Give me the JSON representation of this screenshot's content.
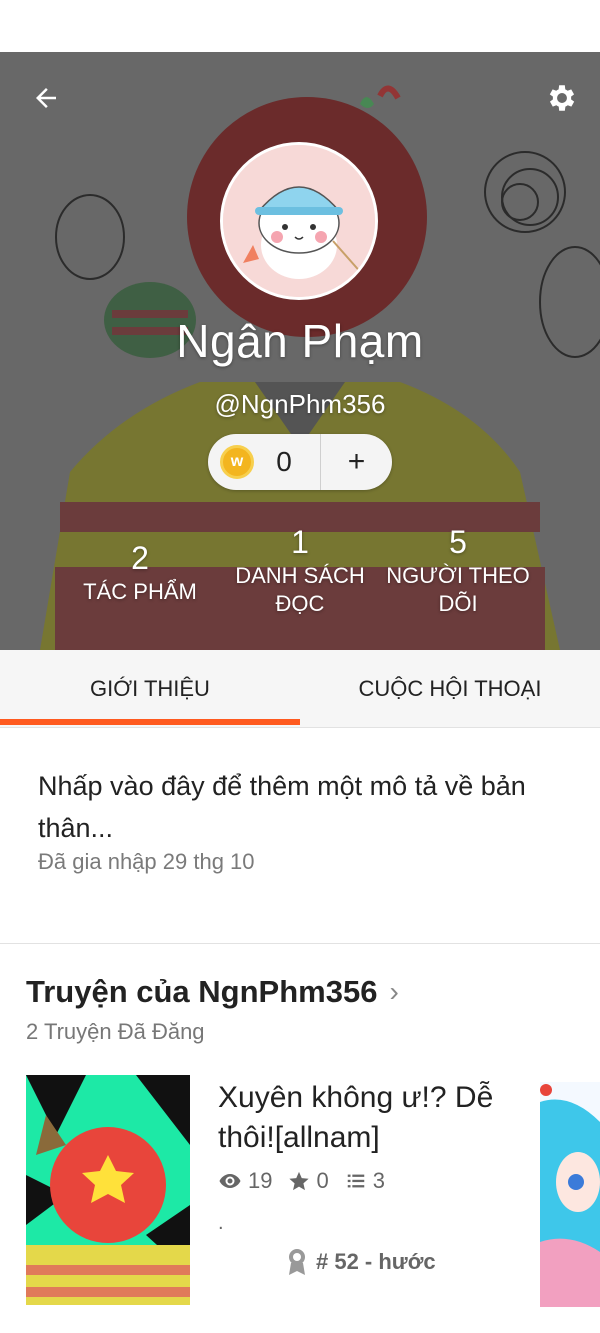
{
  "profile": {
    "display_name": "Ngân Phạm",
    "username": "@NgnPhm356",
    "coins": "0",
    "add_coin_label": "+"
  },
  "stats": [
    {
      "value": "2",
      "label": "TÁC PHẨM"
    },
    {
      "value": "1",
      "label": "DANH SÁCH ĐỌC"
    },
    {
      "value": "5",
      "label": "NGƯỜI THEO DÕI"
    }
  ],
  "tabs": {
    "about": "GIỚI THIỆU",
    "conversations": "CUỘC HỘI THOẠI"
  },
  "about": {
    "prompt": "Nhấp vào đây để thêm một mô tả về bản thân...",
    "joined": "Đã gia nhập 29 thg 10"
  },
  "stories_section": {
    "title": "Truyện của NgnPhm356",
    "subtitle": "2 Truyện Đã Đăng"
  },
  "story": {
    "title": "Xuyên không ư!? Dễ thôi![allnam]",
    "views": "19",
    "votes": "0",
    "parts": "3",
    "description": ".",
    "rank": "# 52 - hước"
  },
  "colors": {
    "accent": "#ff5a1f",
    "coin": "#f3b51f"
  },
  "icons": {
    "back": "arrow-left-icon",
    "settings": "gear-icon",
    "coin": "coin-icon",
    "views": "eye-icon",
    "votes": "star-icon",
    "parts": "list-icon",
    "rank": "ribbon-icon",
    "chevron": "chevron-right-icon"
  }
}
